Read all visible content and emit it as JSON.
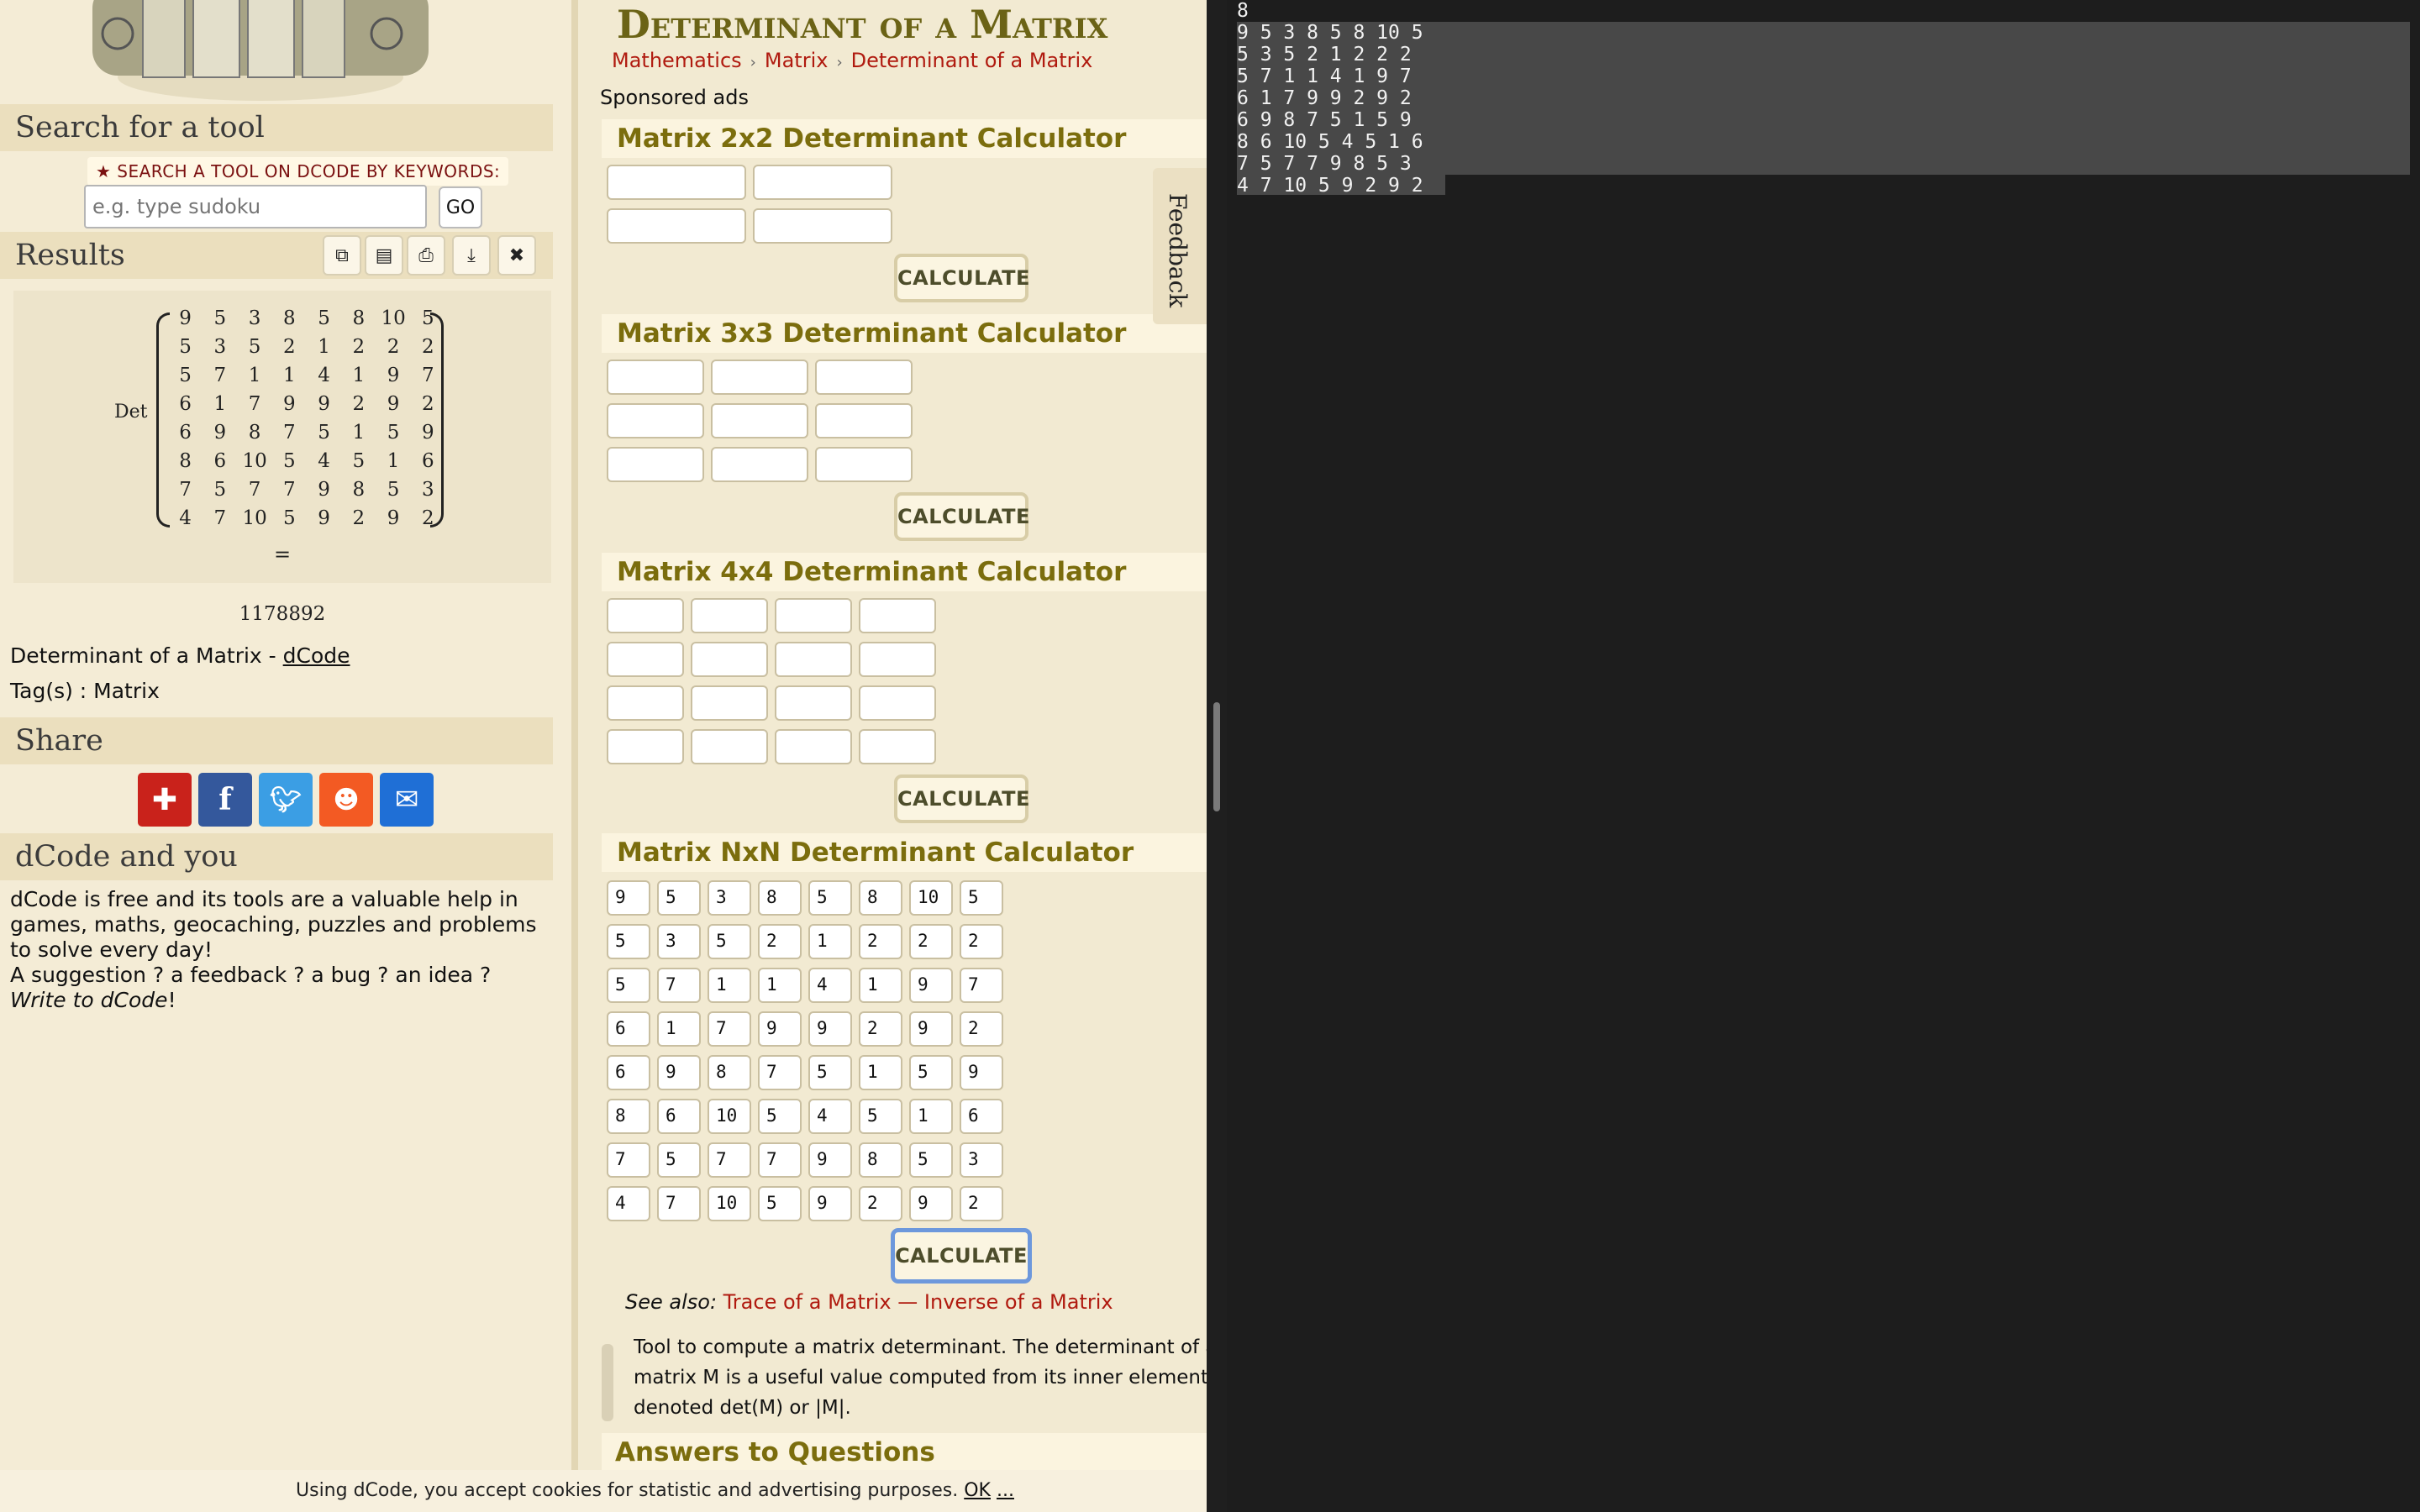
{
  "left": {
    "search_heading": "Search for a tool",
    "search_label": "★ SEARCH A TOOL ON DCODE BY KEYWORDS:",
    "search_placeholder": "e.g. type sudoku",
    "go_label": "GO",
    "results_heading": "Results",
    "result_buttons": [
      "copy-icon",
      "save-icon",
      "print-icon",
      "download-icon",
      "close-icon"
    ],
    "det_label": "Det",
    "matrix": [
      [
        "9",
        "5",
        "3",
        "8",
        "5",
        "8",
        "10",
        "5"
      ],
      [
        "5",
        "3",
        "5",
        "2",
        "1",
        "2",
        "2",
        "2"
      ],
      [
        "5",
        "7",
        "1",
        "1",
        "4",
        "1",
        "9",
        "7"
      ],
      [
        "6",
        "1",
        "7",
        "9",
        "9",
        "2",
        "9",
        "2"
      ],
      [
        "6",
        "9",
        "8",
        "7",
        "5",
        "1",
        "5",
        "9"
      ],
      [
        "8",
        "6",
        "10",
        "5",
        "4",
        "5",
        "1",
        "6"
      ],
      [
        "7",
        "5",
        "7",
        "7",
        "9",
        "8",
        "5",
        "3"
      ],
      [
        "4",
        "7",
        "10",
        "5",
        "9",
        "2",
        "9",
        "2"
      ]
    ],
    "equals": "=",
    "result_value": "1178892",
    "source_prefix": "Determinant of a Matrix - ",
    "source_link": "dCode",
    "tags": "Tag(s) : Matrix",
    "share_heading": "Share",
    "share_icons": [
      "add-icon",
      "facebook-icon",
      "twitter-icon",
      "reddit-icon",
      "mail-icon"
    ],
    "dcode_heading": "dCode and you",
    "about_text": "dCode is free and its tools are a valuable help in games, maths, geocaching, puzzles and problems to solve every day!",
    "suggestion_text": "A suggestion ? a feedback ? a bug ? an idea ? ",
    "suggestion_link": "Write to dCode",
    "suggestion_end": "!"
  },
  "main": {
    "title": "Determinant of a Matrix",
    "breadcrumb": [
      "Mathematics",
      "Matrix",
      "Determinant of a Matrix"
    ],
    "sponsored": "Sponsored ads",
    "calc_2x2_title": "Matrix 2x2 Determinant Calculator",
    "calc_3x3_title": "Matrix 3x3 Determinant Calculator",
    "calc_4x4_title": "Matrix 4x4 Determinant Calculator",
    "calc_nxn_title": "Matrix NxN Determinant Calculator",
    "calculate_label": "CALCULATE",
    "nxn_values": [
      [
        "9",
        "5",
        "3",
        "8",
        "5",
        "8",
        "10",
        "5"
      ],
      [
        "5",
        "3",
        "5",
        "2",
        "1",
        "2",
        "2",
        "2"
      ],
      [
        "5",
        "7",
        "1",
        "1",
        "4",
        "1",
        "9",
        "7"
      ],
      [
        "6",
        "1",
        "7",
        "9",
        "9",
        "2",
        "9",
        "2"
      ],
      [
        "6",
        "9",
        "8",
        "7",
        "5",
        "1",
        "5",
        "9"
      ],
      [
        "8",
        "6",
        "10",
        "5",
        "4",
        "5",
        "1",
        "6"
      ],
      [
        "7",
        "5",
        "7",
        "7",
        "9",
        "8",
        "5",
        "3"
      ],
      [
        "4",
        "7",
        "10",
        "5",
        "9",
        "2",
        "9",
        "2"
      ]
    ],
    "see_also_prefix": "See also: ",
    "see_also_1": "Trace of a Matrix",
    "see_also_sep": " — ",
    "see_also_2": "Inverse of a Matrix",
    "description_lines": [
      "Tool to compute a matrix determinant. The determinant of a s",
      "matrix M is a useful value computed from its inner elements an",
      "denoted det(M) or |M|."
    ],
    "answers_heading": "Answers to Questions",
    "feedback_label": "Feedback",
    "cookie_text": "Using dCode, you accept cookies for statistic and advertising purposes. ",
    "cookie_ok": "OK",
    "cookie_more": "..."
  },
  "terminal": {
    "lines": [
      "8",
      "9 5 3 8 5 8 10 5",
      "5 3 5 2 1 2 2 2",
      "5 7 1 1 4 1 9 7",
      "6 1 7 9 9 2 9 2",
      "6 9 8 7 5 1 5 9",
      "8 6 10 5 4 5 1 6",
      "7 5 7 7 9 8 5 3",
      "4 7 10 5 9 2 9 2"
    ]
  }
}
